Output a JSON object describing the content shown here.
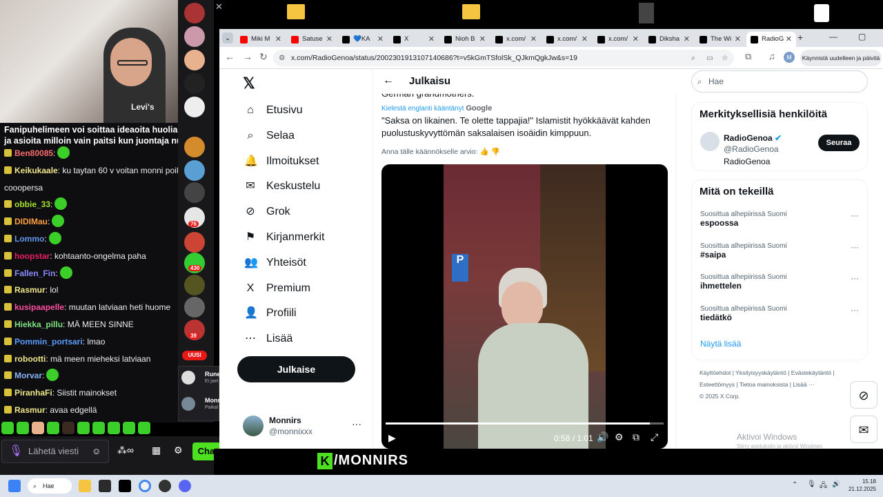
{
  "stream": {
    "banner_line1": "Fanipuhelimeen voi soittaa ideaoita huolia m",
    "banner_line2": "ja asioita milloin vain paitsi kun juontaja nukl",
    "overlay_brand": "/MONNIRS",
    "chat_messages": [
      {
        "user": "Ben80085",
        "user_color": "#fc6d6d",
        "text": ":"
      },
      {
        "user": "Keikukaale",
        "user_color": "#f0e68c",
        "text": ": ku taytan 60 v voitan monni poika"
      },
      {
        "user": "",
        "user_color": "#efeff1",
        "text": "cooopersa"
      },
      {
        "user": "obbie_33",
        "user_color": "#a6e22e",
        "text": ":"
      },
      {
        "user": "DIDIMau",
        "user_color": "#ff9f43",
        "text": ":"
      },
      {
        "user": "Lommo",
        "user_color": "#6495ed",
        "text": ":"
      },
      {
        "user": "hoopstar",
        "user_color": "#e91e63",
        "text": ": kohtaanto-ongelma paha"
      },
      {
        "user": "Fallen_Fin",
        "user_color": "#8a8aff",
        "text": ":"
      },
      {
        "user": "Rasmur",
        "user_color": "#f0e68c",
        "text": ": lol"
      },
      {
        "user": "kusipaapelle",
        "user_color": "#ff4fa3",
        "text": ": muutan latviaan heti huome"
      },
      {
        "user": "Hiekka_pillu",
        "user_color": "#7ee081",
        "text": ": MÄ MEEN SINNE"
      },
      {
        "user": "Pommin_portsari",
        "user_color": "#5b9cff",
        "text": ": lmao"
      },
      {
        "user": "robootti",
        "user_color": "#f0e68c",
        "text": ": mä meen mieheksi latviaan"
      },
      {
        "user": "Morvar",
        "user_color": "#8ab4f8",
        "text": ":"
      },
      {
        "user": "PiranhaFi",
        "user_color": "#f0e68c",
        "text": ": Siistit mainokset"
      },
      {
        "user": "Rasmur",
        "user_color": "#f0e68c",
        "text": ": avaa edgellä"
      }
    ],
    "chat_placeholder": "Lähetä viesti",
    "chat_button": "Chatti",
    "rail_badge_new": "UUSI",
    "rail_counts": [
      "76",
      "430",
      "39"
    ],
    "popup_items": [
      {
        "name": "Rune",
        "sub": "Ei jaet"
      },
      {
        "name": "Monn",
        "sub": "Paikal"
      }
    ]
  },
  "browser": {
    "tabs": [
      {
        "label": "Miki M",
        "icon_color": "#ff0000"
      },
      {
        "label": "Satuse",
        "icon_color": "#ff0000"
      },
      {
        "label": "💙KA",
        "icon_color": "#000000"
      },
      {
        "label": "X",
        "icon_color": "#000000"
      },
      {
        "label": "Nioh B",
        "icon_color": "#000000"
      },
      {
        "label": "x.com/",
        "icon_color": "#000000"
      },
      {
        "label": "x.com/",
        "icon_color": "#000000"
      },
      {
        "label": "x.com/",
        "icon_color": "#000000"
      },
      {
        "label": "Diksha",
        "icon_color": "#000000"
      },
      {
        "label": "The Wi",
        "icon_color": "#000000"
      },
      {
        "label": "RadioG",
        "icon_color": "#000000"
      }
    ],
    "url": "x.com/RadioGenoa/status/2002301913107140686?t=v5kGmTSfolSk_QJkmQgkJw&s=19",
    "restart_label": "Käynnistä uudelleen ja päivitä",
    "profile_letter": "M"
  },
  "x": {
    "nav": [
      {
        "label": "Etusivu",
        "icon": "⌂"
      },
      {
        "label": "Selaa",
        "icon": "⌕"
      },
      {
        "label": "Ilmoitukset",
        "icon": "🔔"
      },
      {
        "label": "Keskustelu",
        "icon": "✉"
      },
      {
        "label": "Grok",
        "icon": "⊘"
      },
      {
        "label": "Kirjanmerkit",
        "icon": "⚑"
      },
      {
        "label": "Yhteisöt",
        "icon": "👥"
      },
      {
        "label": "Premium",
        "icon": "X"
      },
      {
        "label": "Profiili",
        "icon": "👤"
      },
      {
        "label": "Lisää",
        "icon": "⋯"
      }
    ],
    "post_button": "Julkaise",
    "account": {
      "name": "Monnirs",
      "handle": "@monnixxx"
    },
    "header_title": "Julkaisu",
    "tweet": {
      "fragment": "German grandmothers.",
      "translated_note": "Kielestä englanti kääntänyt",
      "translator": "Google",
      "translation": "\"Saksa on likainen. Te olette tappajia!\" Islamistit hyökkäävät kahden puolustuskyvyttömän saksalaisen isoäidin kimppuun.",
      "rate_prompt": "Anna tälle käännökselle arvio:"
    },
    "video": {
      "time": "0:58 / 1:01",
      "progress": 0.95
    },
    "search_placeholder": "Hae",
    "relevant": {
      "title": "Merkityksellisiä henkilöitä",
      "name": "RadioGenoa",
      "handle": "@RadioGenoa",
      "bio": "RadioGenoa",
      "follow": "Seuraa"
    },
    "trending": {
      "title": "Mitä on tekeillä",
      "items": [
        {
          "context": "Suosittua alhepiirissä Suomi",
          "topic": "espoossa"
        },
        {
          "context": "Suosittua alhepiirissä Suomi",
          "topic": "#saipa"
        },
        {
          "context": "Suosittua alhepiirissä Suomi",
          "topic": "ihmettelen"
        },
        {
          "context": "Suosittua alhepiirissä Suomi",
          "topic": "tiedätkö"
        }
      ],
      "more": "Näytä lisää"
    },
    "footer": {
      "line1": [
        "Käyttöehdot",
        "Yksityisyyskäytäntö",
        "Evästekäytäntö"
      ],
      "line2": [
        "Esteettömyys",
        "Tietoa mainoksista",
        "Lisää ···"
      ],
      "copyright": "© 2025 X Corp."
    },
    "watermark1": "Aktivoi Windows",
    "watermark2": "Siirry asetuksiin ja aktivoi Windows"
  },
  "taskbar": {
    "search": "Hae",
    "time": "15.18",
    "date": "21.12.2025"
  }
}
